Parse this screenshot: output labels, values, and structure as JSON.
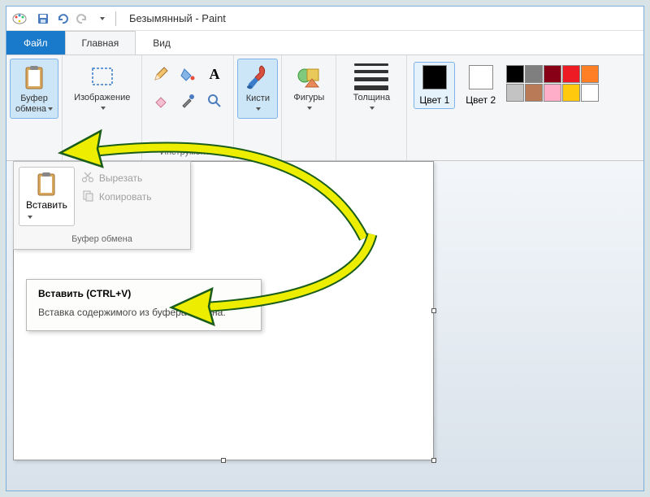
{
  "title": "Безымянный - Paint",
  "tabs": {
    "file": "Файл",
    "home": "Главная",
    "view": "Вид"
  },
  "ribbon": {
    "clipboard": {
      "label": "Буфер\nобмена"
    },
    "image": {
      "label": "Изображение"
    },
    "tools": {
      "group_label": "Инструменты"
    },
    "brushes": {
      "label": "Кисти"
    },
    "shapes": {
      "label": "Фигуры"
    },
    "size": {
      "label": "Толщина"
    },
    "color1": {
      "label": "Цвет\n1",
      "value": "#000000"
    },
    "color2": {
      "label": "Цвет\n2",
      "value": "#ffffff"
    },
    "palette": [
      "#000000",
      "#7f7f7f",
      "#880015",
      "#ed1c24",
      "#c3c3c3",
      "#b97a57",
      "#ffaec9",
      "#ffffff",
      "#ffffff",
      "#ffffff"
    ]
  },
  "dropdown": {
    "paste": "Вставить",
    "cut": "Вырезать",
    "copy": "Копировать",
    "group_label": "Буфер обмена"
  },
  "tooltip": {
    "title": "Вставить (CTRL+V)",
    "body": "Вставка содержимого из буфера обмена."
  },
  "colors": {
    "accent": "#1979ca",
    "highlight": "#cde6f7",
    "arrow": "#eded00"
  }
}
